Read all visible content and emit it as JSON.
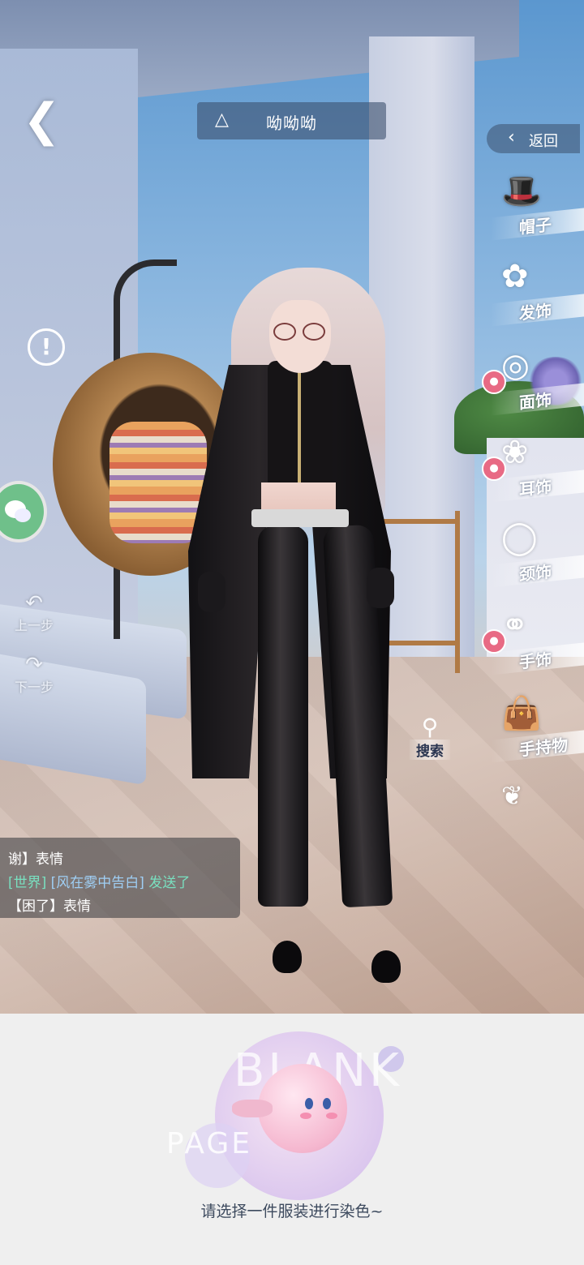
{
  "header": {
    "back_icon": "chevron-left-icon",
    "title": "呦呦呦",
    "title_icon": "dress-icon",
    "return_label": "返回"
  },
  "categories": [
    {
      "label": "帽子",
      "icon": "hat-icon",
      "badge": false
    },
    {
      "label": "发饰",
      "icon": "hairpin-icon",
      "badge": false
    },
    {
      "label": "面饰",
      "icon": "glasses-icon",
      "badge": true
    },
    {
      "label": "耳饰",
      "icon": "earring-icon",
      "badge": true
    },
    {
      "label": "颈饰",
      "icon": "necklace-icon",
      "badge": false
    },
    {
      "label": "手饰",
      "icon": "bracelet-icon",
      "badge": true
    },
    {
      "label": "手持物",
      "icon": "handbag-icon",
      "badge": false
    },
    {
      "label": "",
      "icon": "wings-icon",
      "badge": false
    }
  ],
  "left_tools": {
    "undo_label": "上一步",
    "redo_label": "下一步"
  },
  "search_label": "搜索",
  "chat": {
    "line1": "谢】表情",
    "line2_channel": "[世界]",
    "line2_name": "[风在雾中告白]",
    "line2_action": "发送了",
    "line3": "【困了】表情"
  },
  "empty_state": {
    "blank_word": "BLANK",
    "page_word": "PAGE",
    "hint": "请选择一件服装进行染色~"
  },
  "colors": {
    "accent_badge": "#e86a84",
    "chat_channel": "#79e0c0",
    "chat_name": "#9fcff5"
  }
}
